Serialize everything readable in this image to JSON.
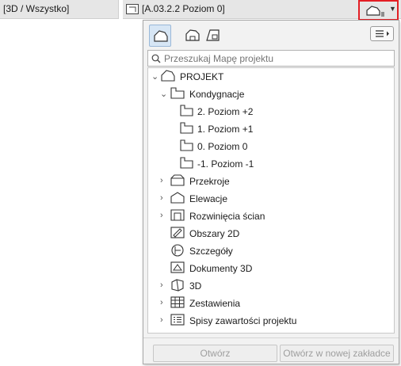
{
  "topbar": {
    "view_name": "[3D / Wszystko]",
    "layer_combo": "[A.03.2.2 Poziom 0]"
  },
  "popup": {
    "toolbar": {
      "buttons": [
        "project-map-icon",
        "view-map-icon",
        "layout-book-icon"
      ],
      "active": "project-map-icon"
    },
    "search": {
      "placeholder": "Przeszukaj Mapę projektu",
      "value": ""
    },
    "tree": {
      "root": "PROJEKT",
      "stories_group": "Kondygnacje",
      "stories": [
        "2. Poziom +2",
        "1. Poziom +1",
        "0. Poziom 0",
        "-1. Poziom -1"
      ],
      "sections": "Przekroje",
      "elevations": "Elewacje",
      "interior_elevations": "Rozwinięcia ścian",
      "worksheets": "Obszary 2D",
      "details": "Szczegóły",
      "documents_3d": "Dokumenty 3D",
      "view_3d": "3D",
      "schedules": "Zestawienia",
      "indexes": "Spisy zawartości projektu"
    },
    "footer": {
      "open": "Otwórz",
      "open_new_tab": "Otwórz w nowej zakładce"
    }
  }
}
